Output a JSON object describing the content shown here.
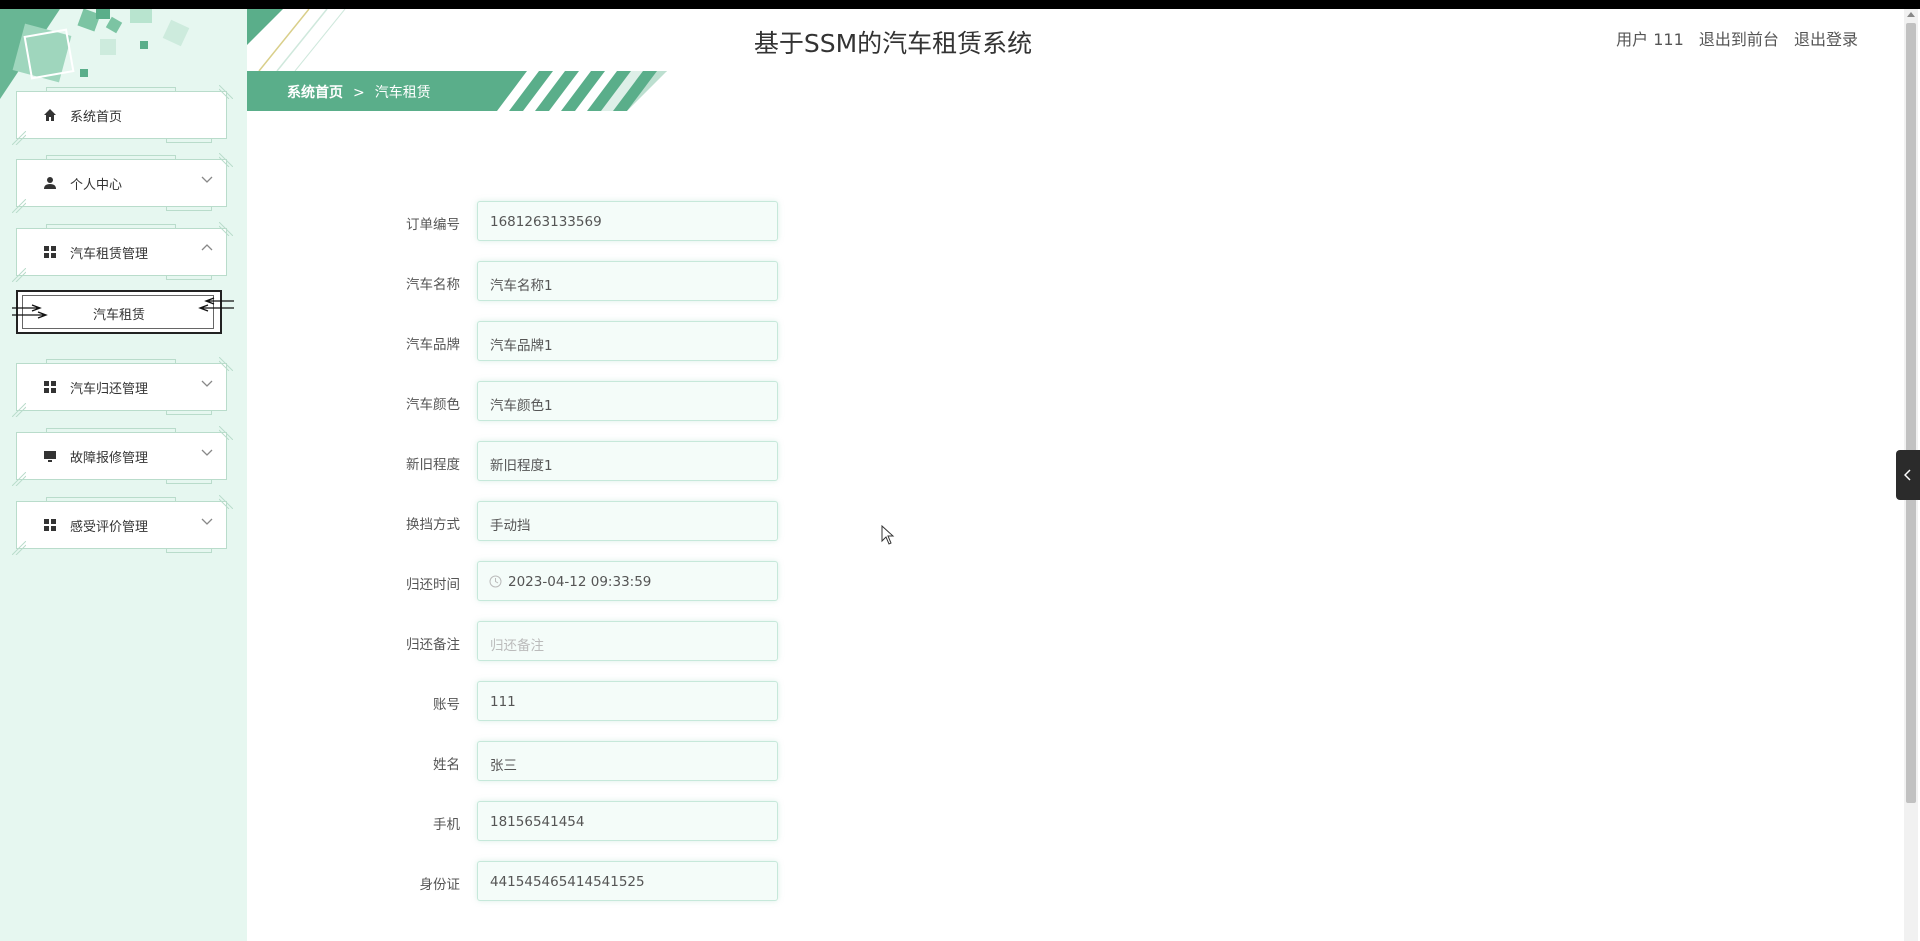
{
  "header": {
    "title": "基于SSM的汽车租赁系统",
    "user_label": "用户 111",
    "exit_front_label": "退出到前台",
    "logout_label": "退出登录"
  },
  "breadcrumb": {
    "home": "系统首页",
    "separator": ">",
    "current": "汽车租赁"
  },
  "sidebar": {
    "items": [
      {
        "label": "系统首页",
        "icon": "home-icon"
      },
      {
        "label": "个人中心",
        "icon": "user-icon",
        "chevron": "down"
      },
      {
        "label": "汽车租赁管理",
        "icon": "grid-icon",
        "chevron": "up"
      },
      {
        "label": "汽车归还管理",
        "icon": "grid-icon",
        "chevron": "down"
      },
      {
        "label": "故障报修管理",
        "icon": "monitor-icon",
        "chevron": "down"
      },
      {
        "label": "感受评价管理",
        "icon": "grid-icon",
        "chevron": "down"
      }
    ],
    "sub_item": {
      "label": "汽车租赁"
    }
  },
  "form": {
    "fields": [
      {
        "label": "订单编号",
        "value": "1681263133569"
      },
      {
        "label": "汽车名称",
        "value": "汽车名称1"
      },
      {
        "label": "汽车品牌",
        "value": "汽车品牌1"
      },
      {
        "label": "汽车颜色",
        "value": "汽车颜色1"
      },
      {
        "label": "新旧程度",
        "value": "新旧程度1"
      },
      {
        "label": "换挡方式",
        "value": "手动挡"
      },
      {
        "label": "归还时间",
        "value": "2023-04-12 09:33:59"
      },
      {
        "label": "归还备注",
        "placeholder": "归还备注"
      },
      {
        "label": "账号",
        "value": "111"
      },
      {
        "label": "姓名",
        "value": "张三"
      },
      {
        "label": "手机",
        "value": "18156541454"
      },
      {
        "label": "身份证",
        "value": "441545465414541525"
      }
    ]
  },
  "colors": {
    "accent": "#5aae8a",
    "sidebar_bg": "#e6f7f0",
    "field_bg": "#f4fcf9",
    "field_border": "#c6e8da"
  },
  "side_tab": {
    "icon": "chevron-left-icon"
  }
}
